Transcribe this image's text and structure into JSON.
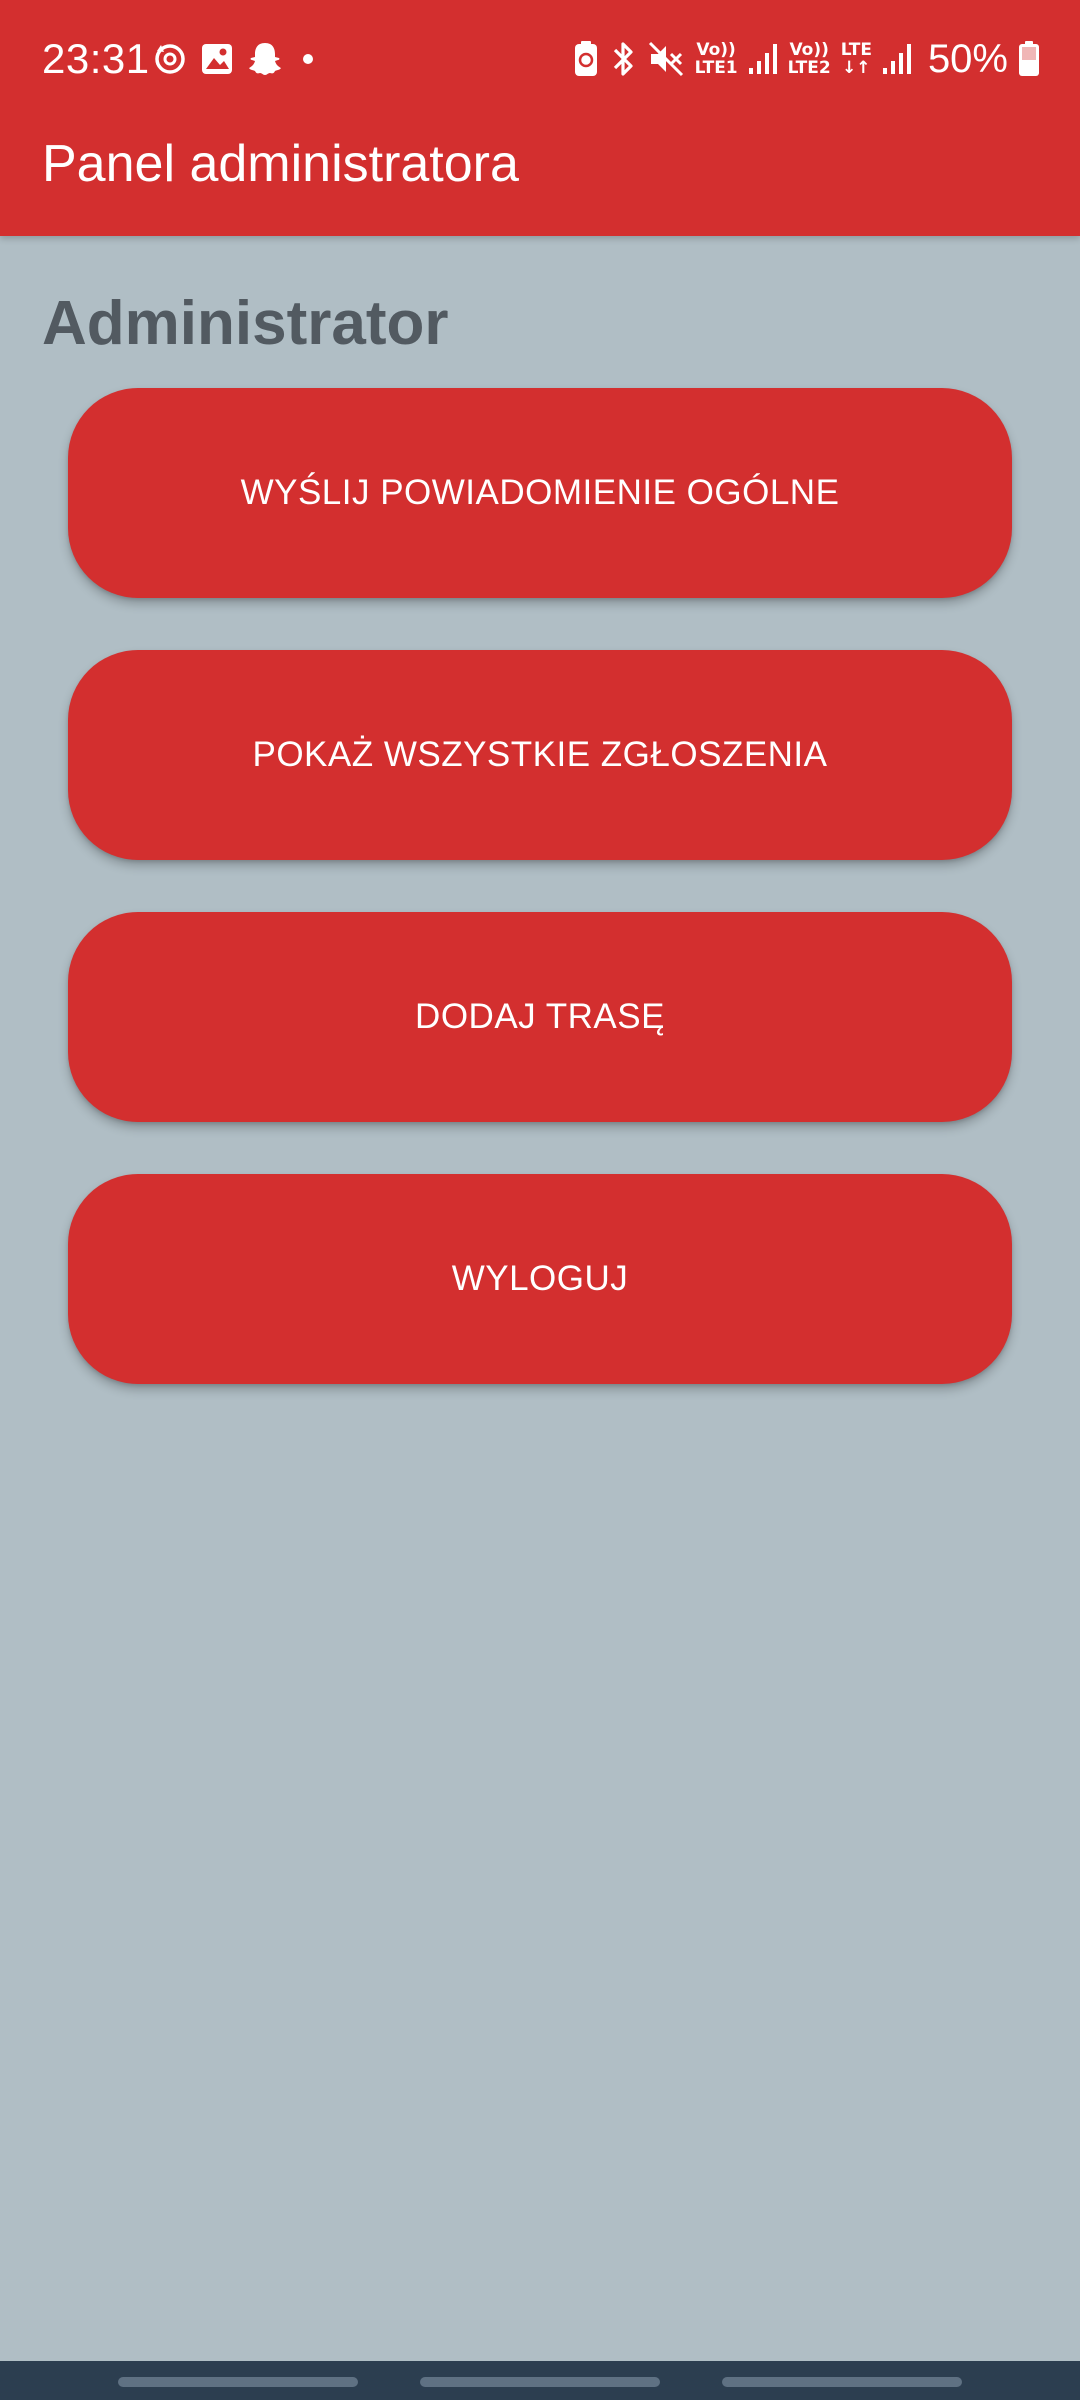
{
  "status_bar": {
    "time": "23:31",
    "left_icons": [
      "sync-icon",
      "gallery-icon",
      "snapchat-icon",
      "dot-icon"
    ],
    "right_icons": [
      "battery-saver-icon",
      "bluetooth-icon",
      "mute-icon",
      "signal-1-icon",
      "signal-2-icon",
      "battery-icon"
    ],
    "sim1_top": "Vo))",
    "sim1_bottom": "LTE1",
    "sim2_top": "Vo))",
    "sim2_bottom": "LTE2",
    "data_top": "LTE",
    "data_bottom": "↓↑",
    "battery_percent": "50%"
  },
  "app_bar": {
    "title": "Panel administratora"
  },
  "main": {
    "heading": "Administrator",
    "buttons": [
      {
        "label": "WYŚLIJ POWIADOMIENIE OGÓLNE"
      },
      {
        "label": "POKAŻ WSZYSTKIE ZGŁOSZENIA"
      },
      {
        "label": "DODAJ TRASĘ"
      },
      {
        "label": "WYLOGUJ"
      }
    ]
  },
  "colors": {
    "primary": "#d32f2f",
    "background": "#b0bec5",
    "heading_text": "#525a61",
    "nav_bar": "#2c3e50"
  }
}
